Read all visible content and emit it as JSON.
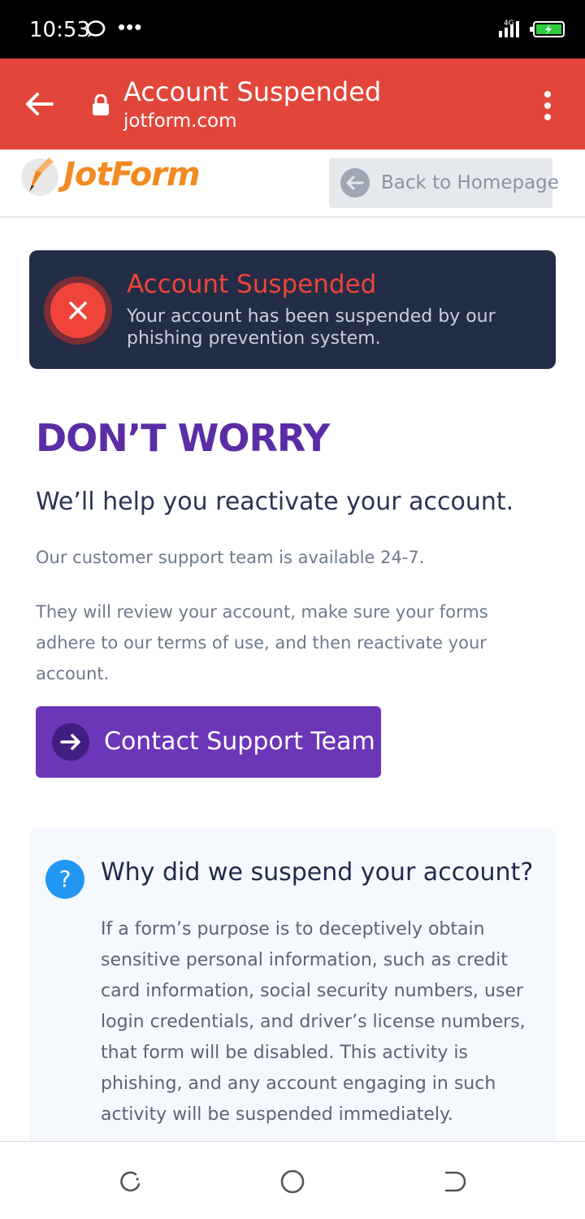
{
  "status_bar": {
    "time": "10:53",
    "network": "4G",
    "icons": [
      "chat-icon",
      "more-dots-icon",
      "signal-icon",
      "battery-icon"
    ]
  },
  "browser": {
    "page_title": "Account Suspended",
    "url": "jotform.com",
    "bar_color": "#e2463a"
  },
  "header": {
    "logo_text": "JotForm",
    "back_button_label": "Back to Homepage"
  },
  "alert": {
    "title": "Account Suspended",
    "message": "Your account has been suspended by our phishing prevention system.",
    "title_color": "#f0443a",
    "background": "#232d45"
  },
  "main": {
    "headline": "DON’T WORRY",
    "subheadline": "We’ll help you reactivate your account.",
    "paragraph_1": "Our customer support team is available 24-7.",
    "paragraph_2": "They will review your account, make sure your forms adhere to our terms of use, and then reactivate your account.",
    "cta_label": "Contact Support Team",
    "accent_color": "#5a2ca6"
  },
  "faq": {
    "question": "Why did we suspend your account?",
    "answer": "If a form’s purpose is to deceptively obtain sensitive personal information, such as credit card information, social security numbers, user login credentials, and driver’s license numbers, that form will be disabled. This activity is phishing, and any account engaging in such activity will be suspended immediately."
  },
  "nav_bar": {
    "icons": [
      "recents-icon",
      "home-icon",
      "back-icon"
    ]
  }
}
